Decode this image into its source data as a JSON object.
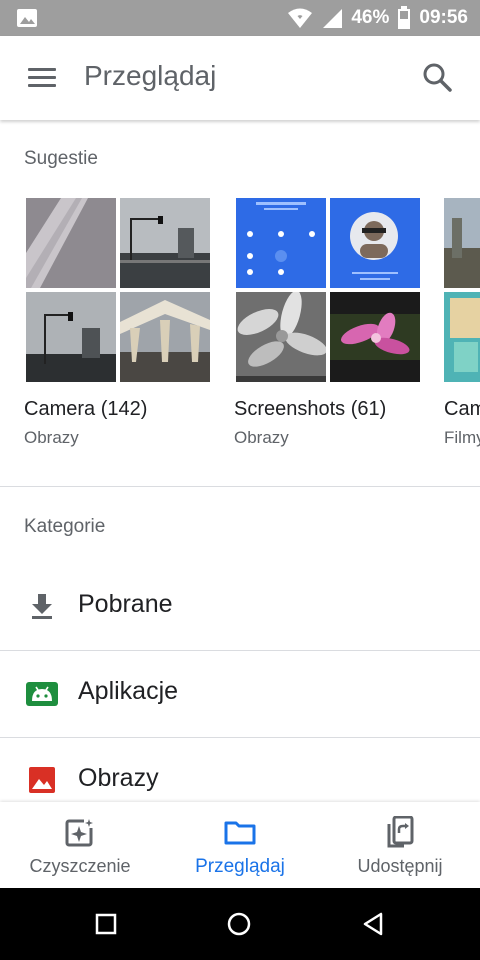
{
  "status_bar": {
    "battery": "46%",
    "time": "09:56",
    "icons": [
      "image-notification-icon",
      "wifi-icon",
      "signal-icon",
      "battery-icon"
    ]
  },
  "app_bar": {
    "title": "Przeglądaj",
    "icons": [
      "menu-icon",
      "search-icon"
    ]
  },
  "suggestions": {
    "heading": "Sugestie",
    "albums": [
      {
        "name": "Camera (142)",
        "type": "Obrazy"
      },
      {
        "name": "Screenshots (61)",
        "type": "Obrazy"
      },
      {
        "name": "Cam",
        "type": "Filmy"
      }
    ]
  },
  "categories": {
    "heading": "Kategorie",
    "items": [
      {
        "label": "Pobrane",
        "icon": "download-icon",
        "color": "#5f6368"
      },
      {
        "label": "Aplikacje",
        "icon": "android-icon",
        "color": "#1e8e3e"
      },
      {
        "label": "Obrazy",
        "icon": "image-icon",
        "color": "#d93025"
      }
    ]
  },
  "bottom_nav": {
    "items": [
      {
        "label": "Czyszczenie",
        "icon": "clean-sparkle-icon",
        "active": false
      },
      {
        "label": "Przeglądaj",
        "icon": "folder-icon",
        "active": true
      },
      {
        "label": "Udostępnij",
        "icon": "share-device-icon",
        "active": false
      }
    ]
  },
  "system_nav": {
    "icons": [
      "recents-square-icon",
      "home-circle-icon",
      "back-triangle-icon"
    ]
  },
  "colors": {
    "accent": "#1a73e8",
    "status_bar": "#9e9e9e",
    "text_secondary": "#5f6368"
  }
}
